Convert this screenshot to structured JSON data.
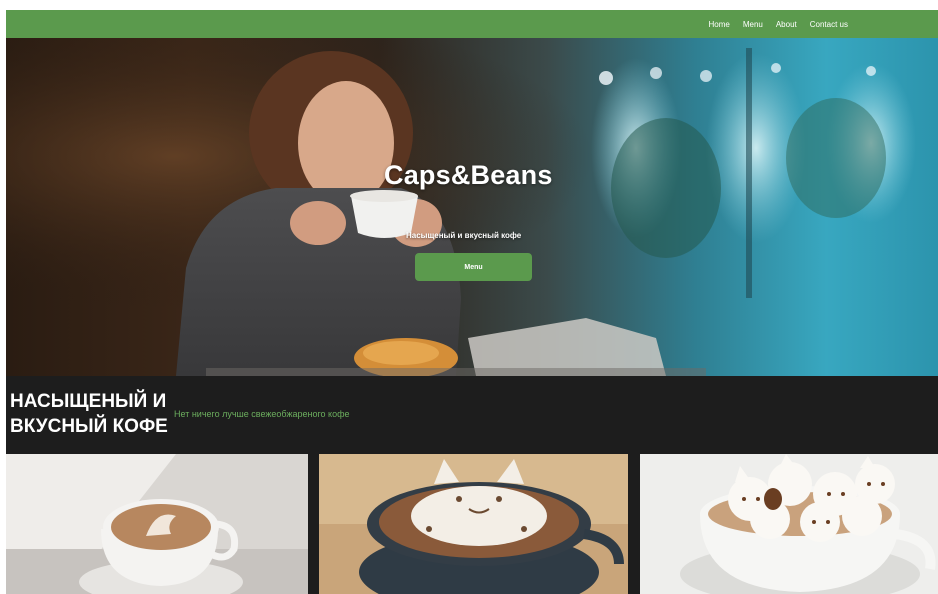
{
  "nav": {
    "items": [
      {
        "label": "Home"
      },
      {
        "label": "Menu"
      },
      {
        "label": "About"
      },
      {
        "label": "Contact us"
      }
    ]
  },
  "hero": {
    "title": "Caps&Beans",
    "subtitle": "Насыщеный и вкусный кофе",
    "button_label": "Menu"
  },
  "tagline": {
    "heading": "НАСЫЩЕНЫЙ И ВКУСНЫЙ КОФЕ",
    "text": "Нет ничего лучше свежеобжареного кофе"
  },
  "colors": {
    "accent_green": "#5b9a4d",
    "dark_strip": "#1d1d1d",
    "tagline_green": "#6cae5e"
  }
}
